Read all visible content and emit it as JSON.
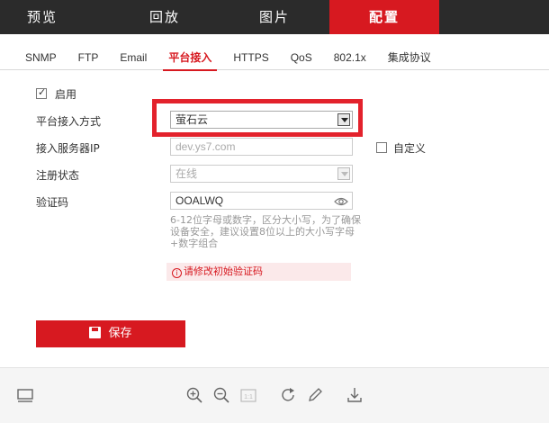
{
  "topnav": {
    "tabs": [
      {
        "label": "预览",
        "active": false
      },
      {
        "label": "回放",
        "active": false
      },
      {
        "label": "图片",
        "active": false
      },
      {
        "label": "配置",
        "active": true
      }
    ]
  },
  "subtabs": [
    {
      "label": "SNMP",
      "active": false
    },
    {
      "label": "FTP",
      "active": false
    },
    {
      "label": "Email",
      "active": false
    },
    {
      "label": "平台接入",
      "active": true
    },
    {
      "label": "HTTPS",
      "active": false
    },
    {
      "label": "QoS",
      "active": false
    },
    {
      "label": "802.1x",
      "active": false
    },
    {
      "label": "集成协议",
      "active": false
    }
  ],
  "form": {
    "enable_label": "启用",
    "enable_checked": true,
    "access_mode_label": "平台接入方式",
    "access_mode_value": "萤石云",
    "server_ip_label": "接入服务器IP",
    "server_ip_value": "dev.ys7.com",
    "custom_label": "自定义",
    "custom_checked": false,
    "register_status_label": "注册状态",
    "register_status_value": "在线",
    "verify_code_label": "验证码",
    "verify_code_value": "OOALWQ",
    "hint_text": "6-12位字母或数字，区分大小写，为了确保设备安全，建议设置8位以上的大小写字母+数字组合",
    "error_text": "请修改初始验证码",
    "save_label": "保存"
  },
  "colors": {
    "accent": "#d71920",
    "nav_bg": "#2b2b2b",
    "highlight": "#e3222c"
  },
  "toolbar_icons": [
    "layout-icon",
    "zoom-in-icon",
    "zoom-out-icon",
    "actual-size-icon",
    "rotate-icon",
    "pencil-icon",
    "download-icon"
  ]
}
